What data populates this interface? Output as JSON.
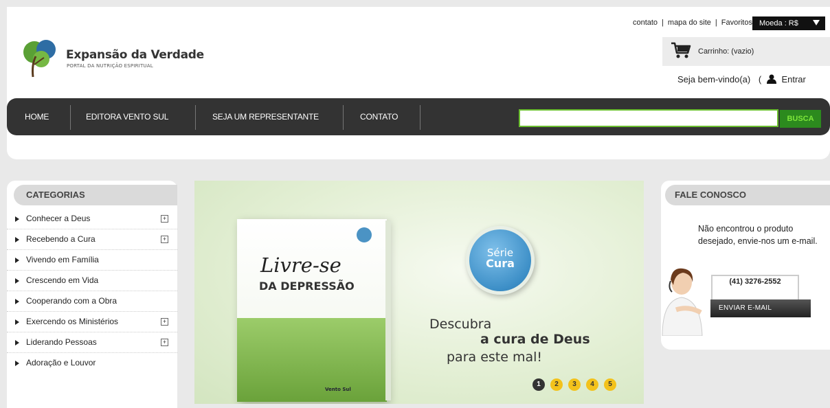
{
  "brand": {
    "name": "Expansão da Verdade",
    "tagline": "PORTAL DA NUTRIÇÃO ESPIRITUAL"
  },
  "top_links": {
    "contato": "contato",
    "sep1": "|",
    "mapa": "mapa do site",
    "sep2": "|",
    "favoritos": "Favoritos"
  },
  "currency": {
    "label": "Moeda : R$"
  },
  "cart": {
    "label": "Carrinho: (vazio)"
  },
  "welcome": {
    "text": "Seja bem-vindo(a)",
    "paren": "(",
    "login": "Entrar"
  },
  "nav": {
    "items": [
      "HOME",
      "EDITORA VENTO SUL",
      "SEJA UM REPRESENTANTE",
      "CONTATO"
    ],
    "search_button": "BUSCA",
    "search_value": ""
  },
  "categories": {
    "title": "CATEGORIAS",
    "items": [
      {
        "label": "Conhecer a Deus",
        "expand": "+"
      },
      {
        "label": "Recebendo a Cura",
        "expand": "+"
      },
      {
        "label": "Vivendo em Família",
        "expand": ""
      },
      {
        "label": "Crescendo em Vida",
        "expand": ""
      },
      {
        "label": "Cooperando com a Obra",
        "expand": ""
      },
      {
        "label": "Exercendo os Ministérios",
        "expand": "+"
      },
      {
        "label": "Liderando Pessoas",
        "expand": "+"
      },
      {
        "label": "Adoração e Louvor",
        "expand": ""
      }
    ]
  },
  "banner": {
    "book_title": "Livre-se",
    "book_subtitle": "DA DEPRESSÃO",
    "publisher": "Vento Sul",
    "badge_line1": "Série",
    "badge_line2": "Cura",
    "headline1": "Descubra",
    "headline2": "a cura de Deus",
    "headline3": "para este mal!",
    "slides": [
      "1",
      "2",
      "3",
      "4",
      "5"
    ],
    "active_slide": 1
  },
  "contact": {
    "title": "FALE CONOSCO",
    "text": "Não encontrou o produto desejado, envie-nos um e-mail.",
    "phone": "(41) 3276-2552",
    "button": "ENVIAR E-MAIL"
  },
  "colors": {
    "nav_bg": "#333333",
    "search_border": "#6bbf2f",
    "search_btn": "#2c8a1e",
    "slide_dot": "#f3c21b",
    "badge_blue": "#3d8fc7"
  }
}
